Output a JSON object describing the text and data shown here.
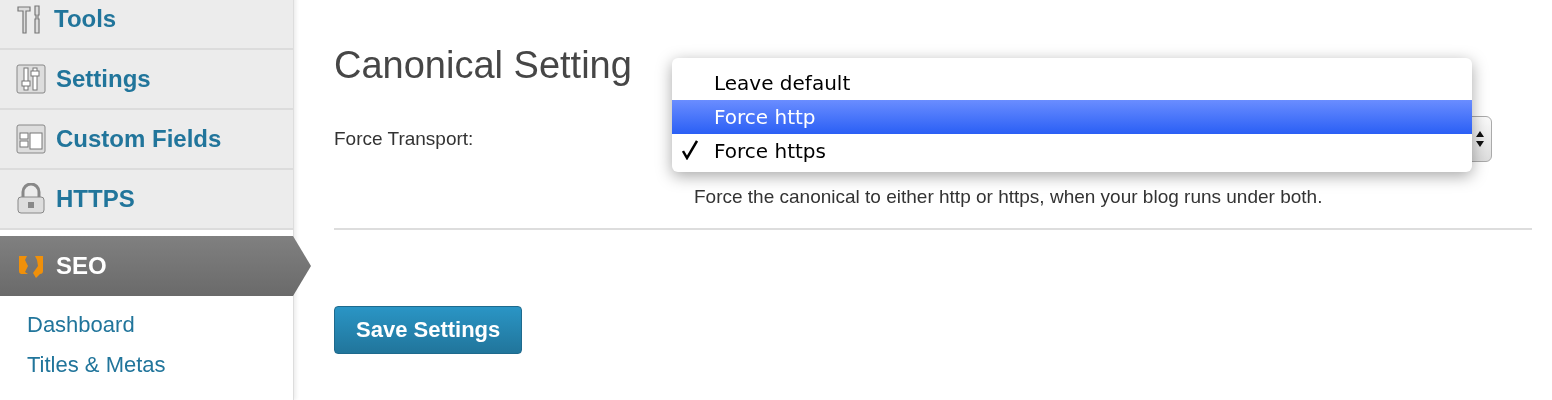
{
  "sidebar": {
    "items": [
      {
        "label": "Tools",
        "selected": false
      },
      {
        "label": "Settings",
        "selected": false
      },
      {
        "label": "Custom Fields",
        "selected": false
      },
      {
        "label": "HTTPS",
        "selected": false
      },
      {
        "label": "SEO",
        "selected": true
      }
    ],
    "submenu": [
      {
        "label": "Dashboard"
      },
      {
        "label": "Titles & Metas"
      }
    ]
  },
  "heading": "Canonical Setting",
  "field": {
    "label": "Force Transport:",
    "description": "Force the canonical to either http or https, when your blog runs under both."
  },
  "dropdown": {
    "options": [
      {
        "label": "Leave default",
        "highlighted": false,
        "checked": false
      },
      {
        "label": "Force http",
        "highlighted": true,
        "checked": false
      },
      {
        "label": "Force https",
        "highlighted": false,
        "checked": true
      }
    ]
  },
  "save_button": "Save Settings"
}
